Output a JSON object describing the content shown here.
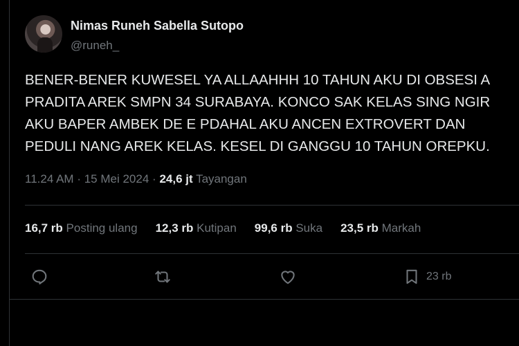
{
  "author": {
    "display_name": "Nimas Runeh Sabella Sutopo",
    "handle": "@runeh_"
  },
  "tweet": {
    "lines": [
      "BENER-BENER KUWESEL YA ALLAAHHH 10 TAHUN AKU DI OBSESI A",
      "PRADITA AREK SMPN 34 SURABAYA. KONCO SAK KELAS SING NGIR",
      "AKU BAPER AMBEK DE E PDAHAL AKU ANCEN EXTROVERT DAN",
      "PEDULI NANG AREK KELAS. KESEL DI GANGGU 10 TAHUN OREPKU."
    ]
  },
  "meta": {
    "time": "11.24 AM",
    "separator": "·",
    "date": "15 Mei 2024",
    "views": "24,6 jt",
    "views_label": "Tayangan"
  },
  "stats": {
    "reposts": "16,7 rb",
    "reposts_label": "Posting ulang",
    "quotes": "12,3 rb",
    "quotes_label": "Kutipan",
    "likes": "99,6 rb",
    "likes_label": "Suka",
    "bookmarks": "23,5 rb",
    "bookmarks_label": "Markah"
  },
  "actions": {
    "bookmark_count": "23 rb"
  },
  "icons": [
    "reply-icon",
    "repost-icon",
    "like-icon",
    "bookmark-icon"
  ],
  "colors": {
    "background": "#000000",
    "text": "#e7e9ea",
    "muted": "#71767b",
    "divider": "#2f3336"
  }
}
